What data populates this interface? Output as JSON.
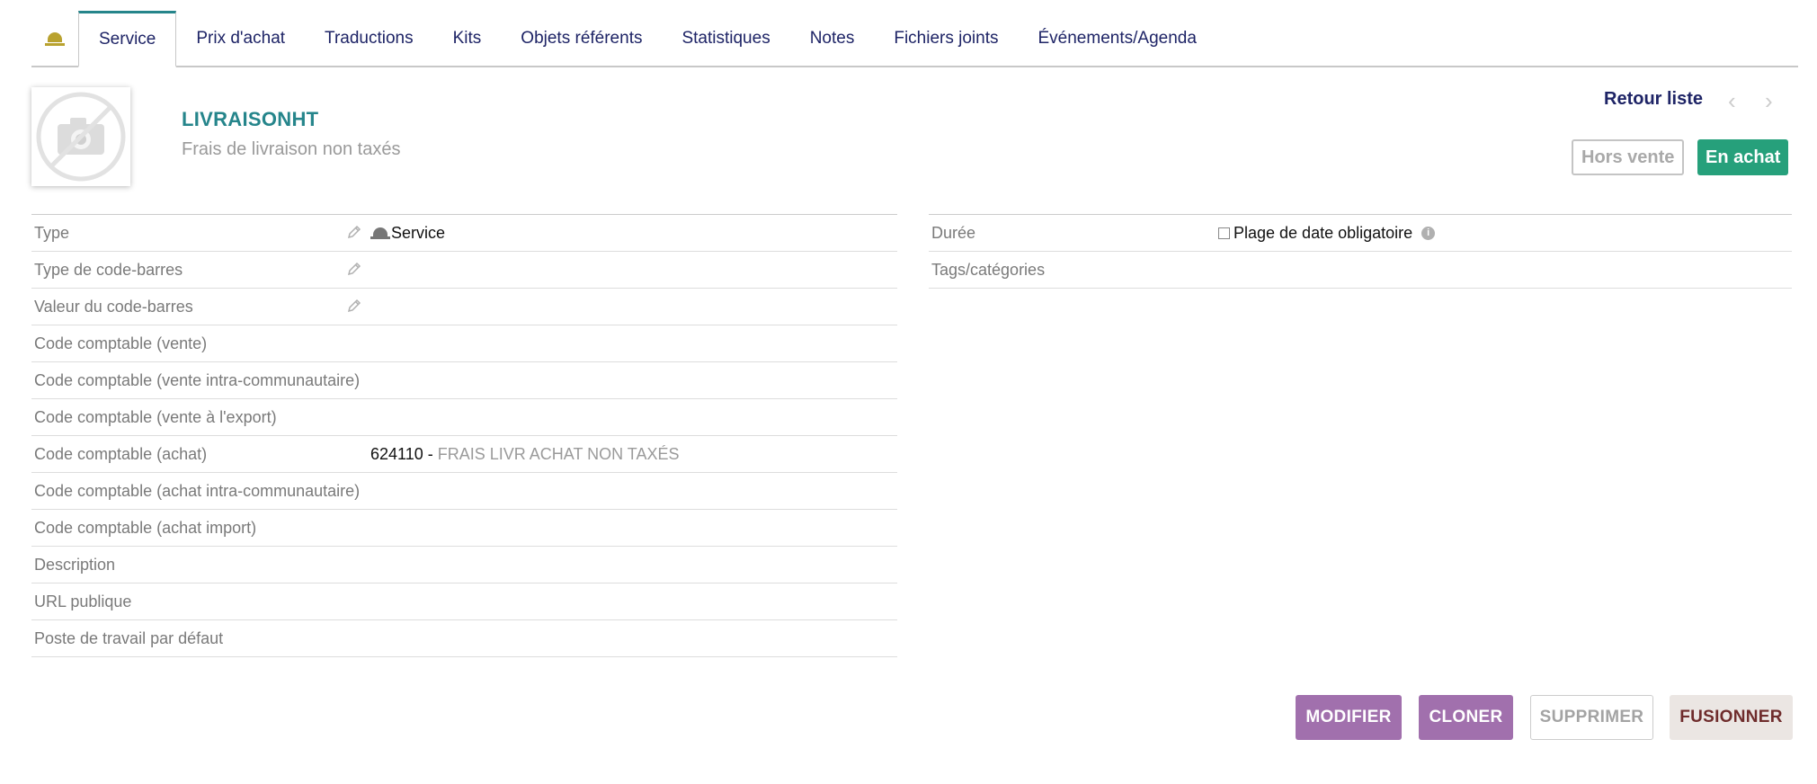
{
  "tabs": [
    {
      "label": ""
    },
    {
      "label": "Service"
    },
    {
      "label": "Prix d'achat"
    },
    {
      "label": "Traductions"
    },
    {
      "label": "Kits"
    },
    {
      "label": "Objets référents"
    },
    {
      "label": "Statistiques"
    },
    {
      "label": "Notes"
    },
    {
      "label": "Fichiers joints"
    },
    {
      "label": "Événements/Agenda"
    }
  ],
  "active_tab": "Service",
  "product": {
    "ref": "LIVRAISONHT",
    "label": "Frais de livraison non taxés",
    "photo_icon": "no-photo-icon"
  },
  "nav": {
    "back_label": "Retour liste",
    "prev_icon": "chevron-left-icon",
    "next_icon": "chevron-right-icon"
  },
  "status": {
    "sell_label": "Hors vente",
    "buy_label": "En achat",
    "buy_color": "#26a07b"
  },
  "left_fields": [
    {
      "label": "Type",
      "value": "Service"
    },
    {
      "label": "Type de code-barres",
      "value": ""
    },
    {
      "label": "Valeur du code-barres",
      "value": ""
    },
    {
      "label": "Code comptable (vente)",
      "value": ""
    },
    {
      "label": "Code comptable (vente intra-communautaire)",
      "value": ""
    },
    {
      "label": "Code comptable (vente à l'export)",
      "value": ""
    },
    {
      "label": "Code comptable (achat)",
      "value_code": "624110",
      "value_sep": " - ",
      "value_desc": "FRAIS LIVR ACHAT NON TAXÉS"
    },
    {
      "label": "Code comptable (achat intra-communautaire)",
      "value": ""
    },
    {
      "label": "Code comptable (achat import)",
      "value": ""
    },
    {
      "label": "Description",
      "value": ""
    },
    {
      "label": "URL publique",
      "value": ""
    },
    {
      "label": "Poste de travail par défaut",
      "value": ""
    }
  ],
  "right_fields": [
    {
      "label": "Durée",
      "checkbox_label": "Plage de date obligatoire"
    },
    {
      "label": "Tags/catégories",
      "value": ""
    }
  ],
  "actions": {
    "modify": "MODIFIER",
    "clone": "CLONER",
    "delete": "SUPPRIMER",
    "merge": "FUSIONNER"
  },
  "colors": {
    "accent": "#25858b",
    "nav_text": "#1e2466",
    "action_purple": "#a170ad"
  }
}
